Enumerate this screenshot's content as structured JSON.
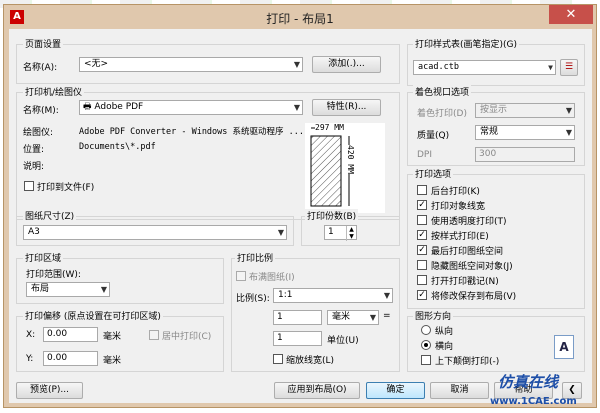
{
  "window": {
    "title": "打印 - 布局1",
    "app_icon": "A",
    "close": "✕"
  },
  "page_setup": {
    "group": "页面设置",
    "name_label": "名称(A):",
    "name_value": "<无>",
    "add_button": "添加(.)..."
  },
  "printer": {
    "group": "打印机/绘图仪",
    "name_label": "名称(M):",
    "name_value": "Adobe PDF",
    "properties_button": "特性(R)...",
    "plotter_label": "绘图仪:",
    "plotter_value": "Adobe PDF Converter - Windows 系统驱动程序 ...",
    "location_label": "位置:",
    "location_value": "Documents\\*.pdf",
    "description_label": "说明:",
    "print_to_file": "打印到文件(F)",
    "preview_width": "297 MM",
    "preview_height": "420 MM"
  },
  "paper_size": {
    "group": "图纸尺寸(Z)",
    "value": "A3"
  },
  "copies": {
    "label": "打印份数(B)",
    "value": "1"
  },
  "print_area": {
    "group": "打印区域",
    "range_label": "打印范围(W):",
    "range_value": "布局"
  },
  "print_offset": {
    "group": "打印偏移 (原点设置在可打印区域)",
    "x_label": "X:",
    "x_value": "0.00",
    "x_unit": "毫米",
    "y_label": "Y:",
    "y_value": "0.00",
    "y_unit": "毫米",
    "center_label": "居中打印(C)"
  },
  "print_scale": {
    "group": "打印比例",
    "fit_label": "布满图纸(I)",
    "scale_label": "比例(S):",
    "scale_value": "1:1",
    "val1": "1",
    "unit1": "毫米",
    "equals": "=",
    "val2": "1",
    "unit2": "单位(U)",
    "lineweight_label": "缩放线宽(L)"
  },
  "plot_style": {
    "group": "打印样式表(画笔指定)(G)",
    "value": "acad.ctb"
  },
  "shaded": {
    "group": "着色视口选项",
    "shade_label": "着色打印(D)",
    "shade_value": "按显示",
    "quality_label": "质量(Q)",
    "quality_value": "常规",
    "dpi_label": "DPI",
    "dpi_value": "300"
  },
  "options": {
    "group": "打印选项",
    "items": [
      {
        "label": "后台打印(K)",
        "check": ""
      },
      {
        "label": "打印对象线宽",
        "check": "✓"
      },
      {
        "label": "使用透明度打印(T)",
        "check": ""
      },
      {
        "label": "按样式打印(E)",
        "check": "✓"
      },
      {
        "label": "最后打印图纸空间",
        "check": "✓"
      },
      {
        "label": "隐藏图纸空间对象(J)",
        "check": ""
      },
      {
        "label": "打开打印戳记(N)",
        "check": ""
      },
      {
        "label": "将修改保存到布局(V)",
        "check": "✓"
      }
    ]
  },
  "orientation": {
    "group": "图形方向",
    "portrait": "纵向",
    "landscape": "横向",
    "upside_down": "上下颠倒打印(-)",
    "icon": "A"
  },
  "footer": {
    "preview": "预览(P)...",
    "apply": "应用到布局(O)",
    "ok": "确定",
    "cancel": "取消",
    "help": "帮助"
  },
  "watermark": {
    "text": "仿真在线",
    "site": "www.1CAE.com"
  }
}
